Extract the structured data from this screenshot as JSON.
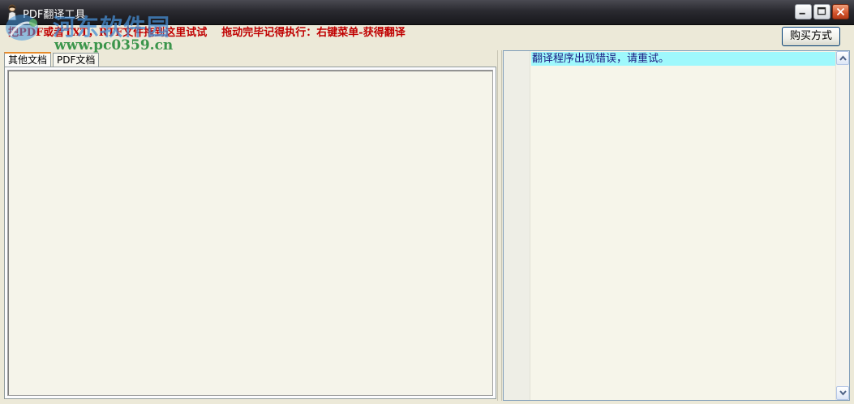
{
  "window": {
    "title": "PDF翻译工具"
  },
  "watermark": {
    "site_name": "河东软件园",
    "url": "www.pc0359.cn"
  },
  "instruction_text": "把PDF或者TXT，RTF文件拖到这里试试    拖动完毕记得执行：右键菜单-获得翻译",
  "toolbar": {
    "buy_label": "购买方式"
  },
  "tabs": [
    {
      "label": "其他文档",
      "active": true
    },
    {
      "label": "PDF文档",
      "active": false
    }
  ],
  "output": {
    "lines": [
      "翻译程序出现错误，请重试。"
    ]
  },
  "colors": {
    "instruction": "#c00000",
    "highlight": "#9ff8fc",
    "tab_accent": "#e68b2c"
  }
}
